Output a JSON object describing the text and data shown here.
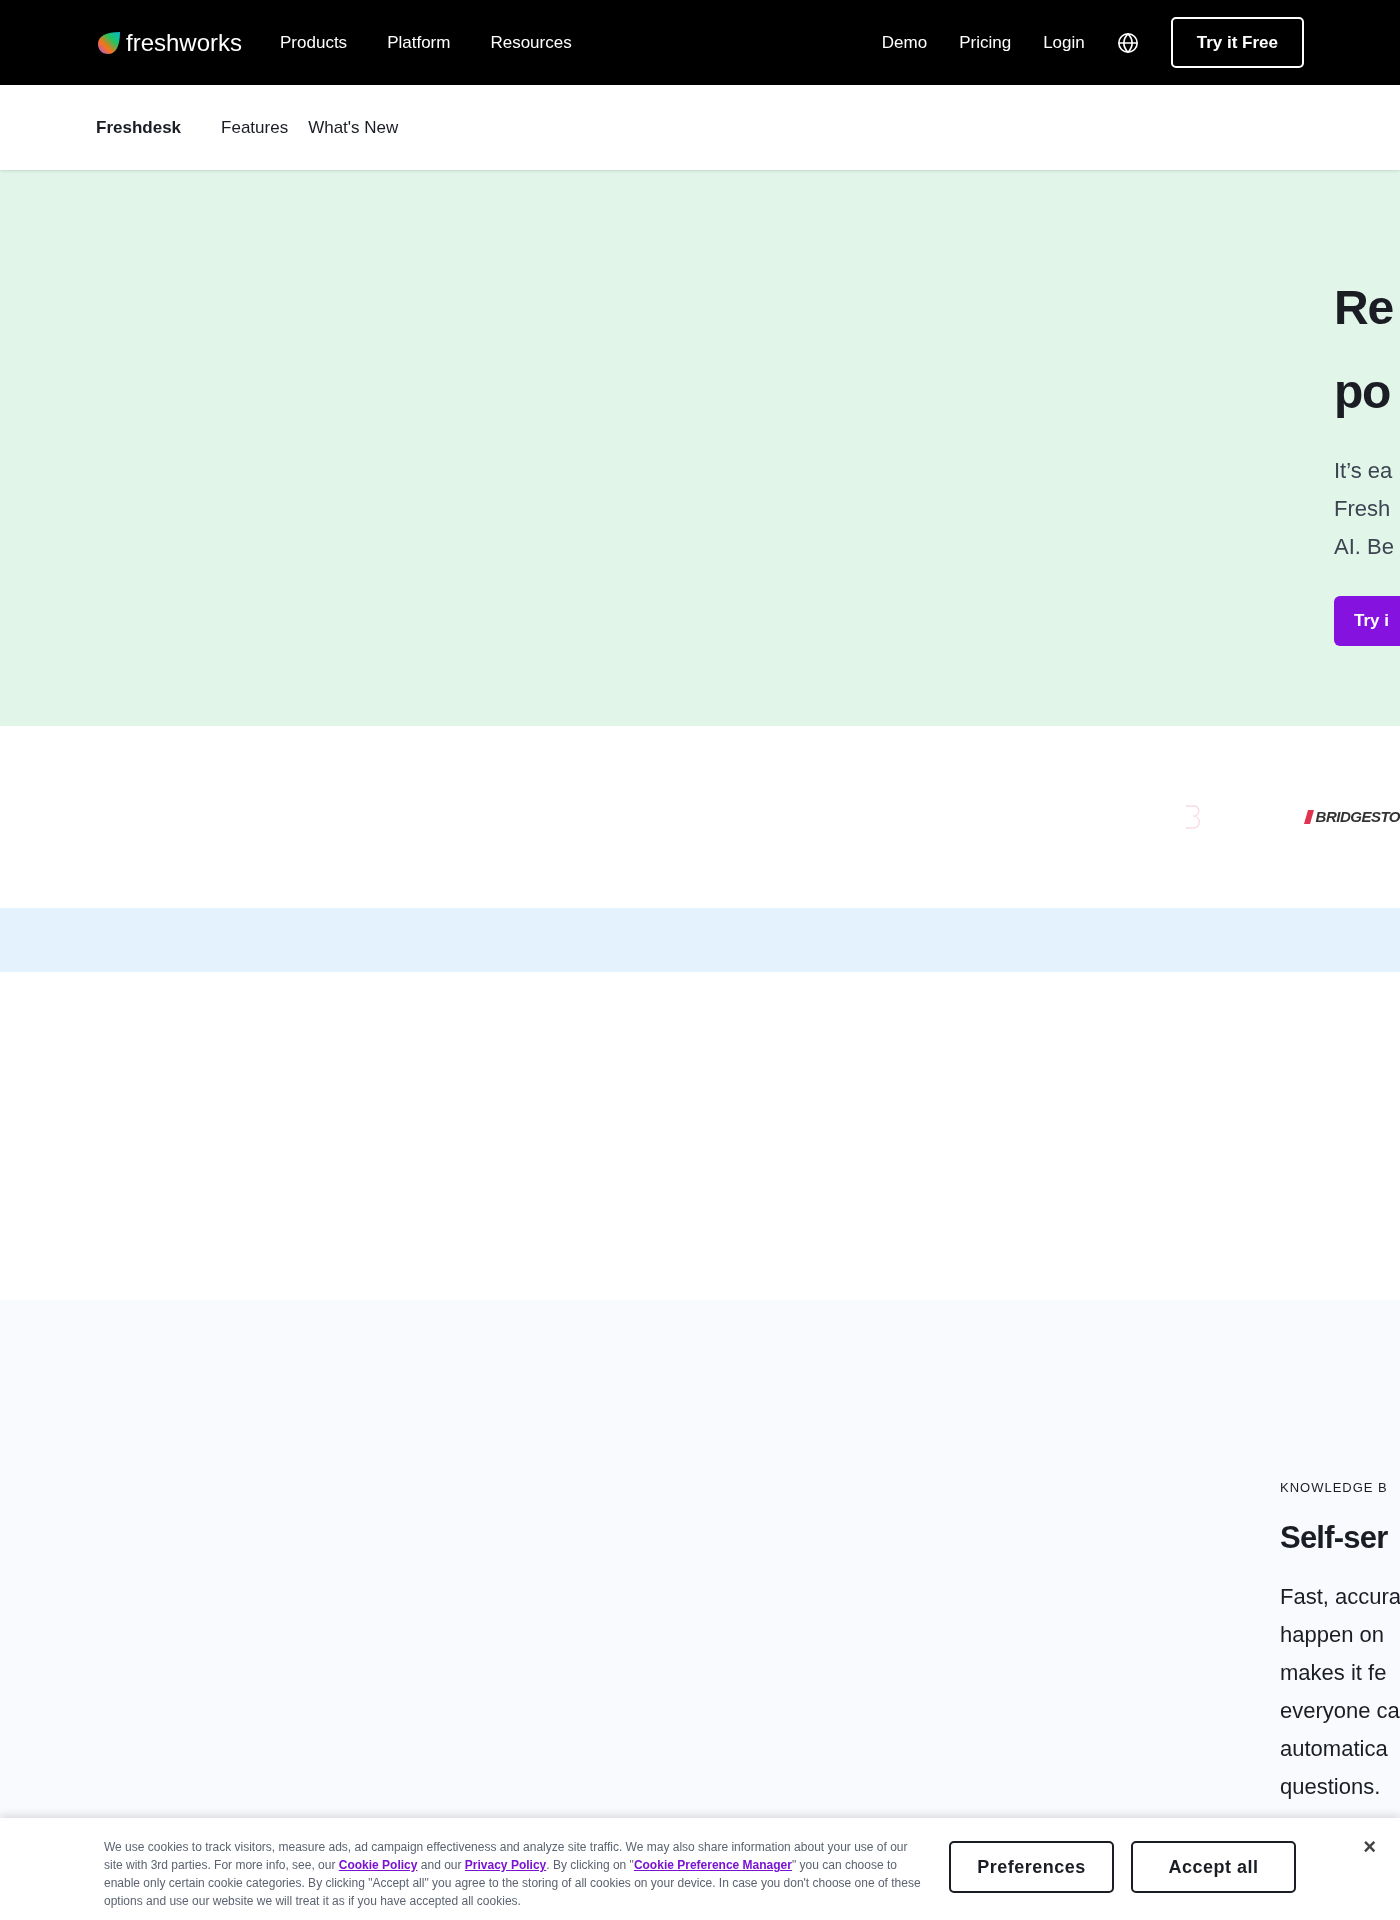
{
  "header": {
    "brand": "freshworks",
    "nav": [
      "Products",
      "Platform",
      "Resources"
    ],
    "links": [
      "Demo",
      "Pricing",
      "Login"
    ],
    "cta": "Try it Free"
  },
  "subnav": {
    "product": "Freshdesk",
    "items": [
      "Features",
      "What's New"
    ]
  },
  "hero": {
    "title_lines": [
      "Re",
      "po"
    ],
    "body_lines": [
      "It’s ea",
      "Fresh",
      "AI. Be"
    ],
    "cta": "Try i"
  },
  "logos": {
    "brand_text": "BRIDGESTO"
  },
  "knowledge": {
    "eyebrow": "KNOWLEDGE B",
    "title": "Self-ser",
    "body_lines": [
      "Fast, accura",
      "happen on",
      "makes it fe",
      "everyone ca",
      "automatica",
      "questions."
    ]
  },
  "cookie_banner": {
    "parts": [
      {
        "kind": "text",
        "text": "We use cookies to track visitors, measure ads, ad campaign effectiveness and analyze site traffic. We may also share information about your use of our site with 3rd parties. For more info, see, our "
      },
      {
        "kind": "link",
        "text": "Cookie Policy"
      },
      {
        "kind": "text",
        "text": " and our "
      },
      {
        "kind": "link",
        "text": "Privacy Policy"
      },
      {
        "kind": "text",
        "text": ". By clicking on \""
      },
      {
        "kind": "link",
        "text": "Cookie Preference Manager"
      },
      {
        "kind": "text",
        "text": "\" you can choose to enable only certain cookie categories. By clicking \"Accept all\" you agree to the storing of all cookies on your device. In case you don't choose one of these options and use our website we will treat it as if you have accepted all cookies."
      }
    ],
    "buttons": [
      "Preferences",
      "Accept all"
    ],
    "close": "×"
  }
}
